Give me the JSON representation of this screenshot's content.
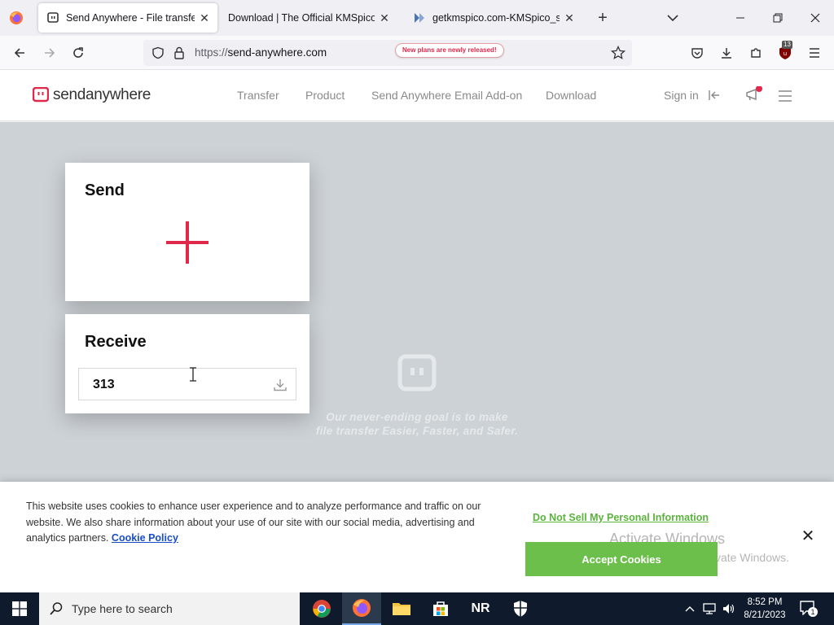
{
  "browser": {
    "tabs": [
      {
        "label": "Send Anywhere - File transfer",
        "active": true
      },
      {
        "label": "Download | The Official KMSpico Si",
        "active": false
      },
      {
        "label": "getkmspico.com-KMSpico_setu",
        "active": false
      }
    ],
    "url_scheme": "https://",
    "url_host": "send-anywhere.com",
    "extension_badge": "13"
  },
  "site": {
    "logo_send": "send",
    "logo_anywhere": "anywhere",
    "nav": [
      "Transfer",
      "Product",
      "Send Anywhere Email Add-on",
      "Download"
    ],
    "signin": "Sign in",
    "promo": "New plans are newly released!",
    "accent": "#e0284a"
  },
  "send_card": {
    "title": "Send"
  },
  "receive_card": {
    "title": "Receive",
    "code_value": "313"
  },
  "tagline": [
    "Our never-ending goal is to make",
    "file transfer Easier, Faster, and Safer."
  ],
  "cookie": {
    "text": "This website uses cookies to enhance user experience and to analyze performance and traffic on our website. We also share information about your use of our site with our social media, advertising and analytics partners.",
    "policy_link": "Cookie Policy",
    "do_not_sell": "Do Not Sell My Personal Information",
    "accept": "Accept Cookies",
    "accept_color": "#6cbf4b"
  },
  "watermark": {
    "line1": "Activate Windows",
    "line2": "Go to Settings to activate Windows."
  },
  "taskbar": {
    "search_placeholder": "Type here to search",
    "nr_label": "NR",
    "time": "8:52 PM",
    "date": "8/21/2023",
    "notification_count": "1"
  }
}
